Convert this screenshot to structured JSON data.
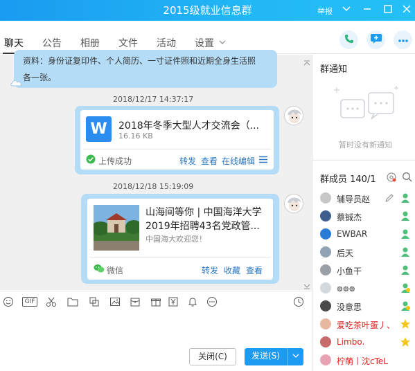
{
  "window": {
    "title": "2015级就业信息群",
    "report_label": "举报"
  },
  "tabs": [
    {
      "label": "聊天"
    },
    {
      "label": "公告"
    },
    {
      "label": "相册"
    },
    {
      "label": "文件"
    },
    {
      "label": "活动"
    },
    {
      "label": "设置"
    }
  ],
  "chat": {
    "partial_message": {
      "line1": "资料：身份证复印件、个人简历、一寸证件照和近期全身生活照",
      "line2": "各一张。"
    },
    "timestamp1": "2018/12/17 14:37:17",
    "file_card": {
      "file_icon_letter": "W",
      "title": "2018年冬季大型人才交流会（...",
      "size": "16.16 KB",
      "status": "上传成功",
      "actions": [
        "转发",
        "查看",
        "在线编辑"
      ]
    },
    "timestamp2": "2018/12/18 15:19:09",
    "share_card": {
      "title_line1": "山海间等你 | 中国海洋大学",
      "title_line2": "2019年招聘43名党政管...",
      "desc": "中国海大欢迎您！",
      "source": "微信",
      "actions": [
        "转发",
        "收藏",
        "查看"
      ]
    }
  },
  "composer": {
    "gif_label": "GIF",
    "close_button": "关闭(C)",
    "send_button": "发送(S)"
  },
  "notice": {
    "heading": "群通知",
    "empty": "暂时没有新通知"
  },
  "members": {
    "heading": "群成员 140/1",
    "list": [
      {
        "name": "辅导员赵",
        "color": "#333333"
      },
      {
        "name": "蔡铖杰",
        "color": "#333333"
      },
      {
        "name": "EWBAR",
        "color": "#333333"
      },
      {
        "name": "后天",
        "color": "#333333"
      },
      {
        "name": "小鱼干",
        "color": "#333333"
      },
      {
        "name": "᪥᪥᪥",
        "color": "#333333"
      },
      {
        "name": "没意思",
        "color": "#333333"
      },
      {
        "name": "爱吃茶叶蛋丿、",
        "color": "#e0201d"
      },
      {
        "name": "Limbo.",
        "color": "#e0201d"
      },
      {
        "name": "柠萌丨沈cTeL",
        "color": "#e0201d"
      }
    ]
  },
  "colors": {
    "accent": "#1a9bf0",
    "bubble": "#b5dcf6",
    "link": "#2776c2",
    "send": "#1c9bf0"
  }
}
